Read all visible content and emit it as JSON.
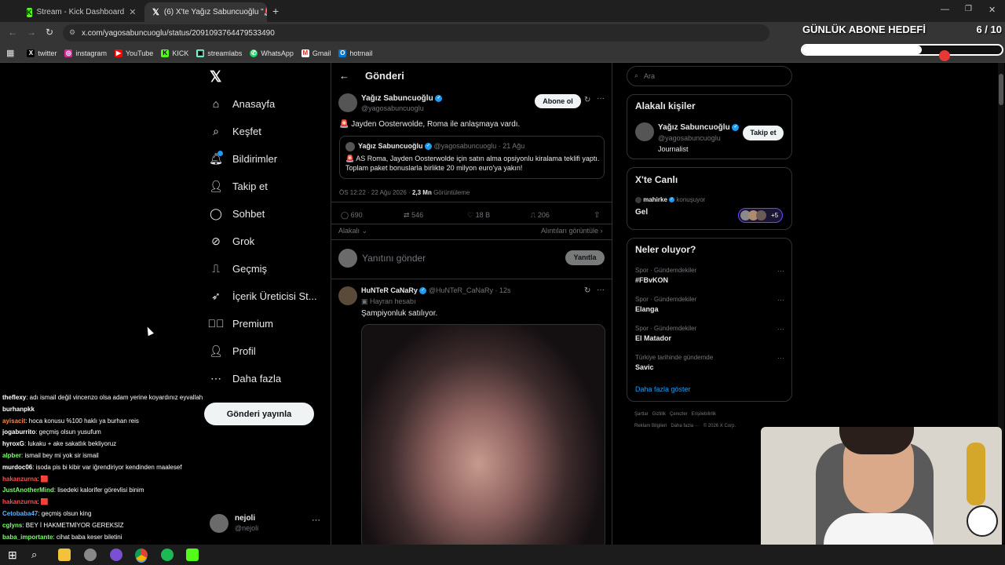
{
  "browser": {
    "tabs": [
      {
        "label": "Stream - Kick Dashboard",
        "icon": "kick-icon"
      },
      {
        "label": "(6) X'te Yağız Sabuncuoğlu \"🚨",
        "icon": "x-icon"
      }
    ],
    "url": "x.com/yagosabuncuoglu/status/2091093764479533490",
    "bookmarks": [
      "twitter",
      "instagram",
      "YouTube",
      "KICK",
      "streamlabs",
      "WhatsApp",
      "Gmail",
      "hotmail"
    ]
  },
  "overlay": {
    "goal_title": "GÜNLÜK ABONE HEDEFİ",
    "goal_count": "6 / 10",
    "goal_progress": 0.6
  },
  "nav": {
    "items": [
      "Anasayfa",
      "Keşfet",
      "Bildirimler",
      "Takip et",
      "Sohbet",
      "Grok",
      "Geçmiş",
      "İçerik Üreticisi St...",
      "Premium",
      "Profil",
      "Daha fazla"
    ],
    "post_button": "Gönderi yayınla",
    "user_name": "nejoli",
    "user_handle": "@nejoli"
  },
  "post": {
    "header": "Gönderi",
    "author": "Yağız Sabuncuoğlu",
    "handle": "@yagosabuncuoglu",
    "follow": "Abone ol",
    "text": "🚨 Jayden Oosterwolde, Roma ile anlaşmaya vardı.",
    "quote_author": "Yağız Sabuncuoğlu",
    "quote_handle": "@yagosabuncuoglu · 21 Ağu",
    "quote_text": "🚨 AS Roma, Jayden Oosterwolde için satın alma opsiyonlu kiralama teklifi yaptı. Toplam paket bonuslarla birlikte 20 milyon euro'ya yakın!",
    "meta_time": "ÖS 12:22 · 22 Ağu 2026 · ",
    "meta_views": "2,3 Mn",
    "meta_views_label": " Görüntüleme",
    "replies": "690",
    "reposts": "546",
    "likes": "18 B",
    "bookmarks": "206",
    "relevance": "Alakalı",
    "quotes_link": "Alıntıları görüntüle",
    "reply_placeholder": "Yanıtını gönder",
    "reply_button": "Yanıtla"
  },
  "reply": {
    "author": "HuNTeR CaNaRy",
    "handle": "@HuNTeR_CaNaRy · 12s",
    "sub": "Hayran hesabı",
    "text": "Şampiyonluk satılıyor."
  },
  "right": {
    "search_placeholder": "Ara",
    "people_title": "Alakalı kişiler",
    "person_name": "Yağız Sabuncuoğlu",
    "person_handle": "@yagosabuncuoglu",
    "person_bio": "Journalist",
    "follow_btn": "Takip et",
    "live_title": "X'te Canlı",
    "live_host": "mahirke",
    "live_status": "konuşuyor",
    "live_text": "Gel",
    "live_extra": "+5",
    "trends_title": "Neler oluyor?",
    "trends": [
      {
        "cat": "Spor · Gündemdekiler",
        "name": "#FBvKON"
      },
      {
        "cat": "Spor · Gündemdekiler",
        "name": "Elanga"
      },
      {
        "cat": "Spor · Gündemdekiler",
        "name": "El Matador"
      },
      {
        "cat": "Türkiye tarihinde gündemde",
        "name": "Savic"
      }
    ],
    "show_more": "Daha fazla göster",
    "footer1": "Şartlar   Gizlilik   Çerezler   Erişilebilirlik",
    "footer2": "Reklam Bilgileri   Daha fazla ···   © 2026 X Corp."
  },
  "chat": [
    {
      "user": "theflexy",
      "color": "#ffffff",
      "msg": ": adı ismail değil vincenzo olsa adam yerine koyardınız eyvallah"
    },
    {
      "user": "",
      "color": "#ffffff",
      "msg": "burhanpkk"
    },
    {
      "user": "ayisacit",
      "color": "#ff8c42",
      "msg": ": hoca konusu %100 haklı ya burhan reis"
    },
    {
      "user": "jogaburrito",
      "color": "#ffffff",
      "msg": ": geçmiş olsun yusufum"
    },
    {
      "user": "hyroxG",
      "color": "#ffffff",
      "msg": ": lukaku + ake sakatlık bekliyoruz"
    },
    {
      "user": "alpber",
      "color": "#7cfc6c",
      "msg": ": ismail bey mi yok sir ismail"
    },
    {
      "user": "murdoc06",
      "color": "#ffffff",
      "msg": ": isoda pis bi kibir var iğrendiriyor kendinden maalesef"
    },
    {
      "user": "hakanzurna",
      "color": "#ff4d4d",
      "msg": ": 🟥"
    },
    {
      "user": "JustAnotherMind",
      "color": "#7cfc6c",
      "msg": ": lisedeki kalorifer görevlisi binim"
    },
    {
      "user": "hakanzurna",
      "color": "#ff4d4d",
      "msg": ": 🟥"
    },
    {
      "user": "Cetobaba47",
      "color": "#5ab4ff",
      "msg": ": geçmiş olsun king"
    },
    {
      "user": "cglyns",
      "color": "#7cfc6c",
      "msg": ": BEY İ HAKMETMİYOR GEREKSİZ"
    },
    {
      "user": "baba_importante",
      "color": "#7cfc6c",
      "msg": ": cihat baba keser biletini"
    }
  ]
}
